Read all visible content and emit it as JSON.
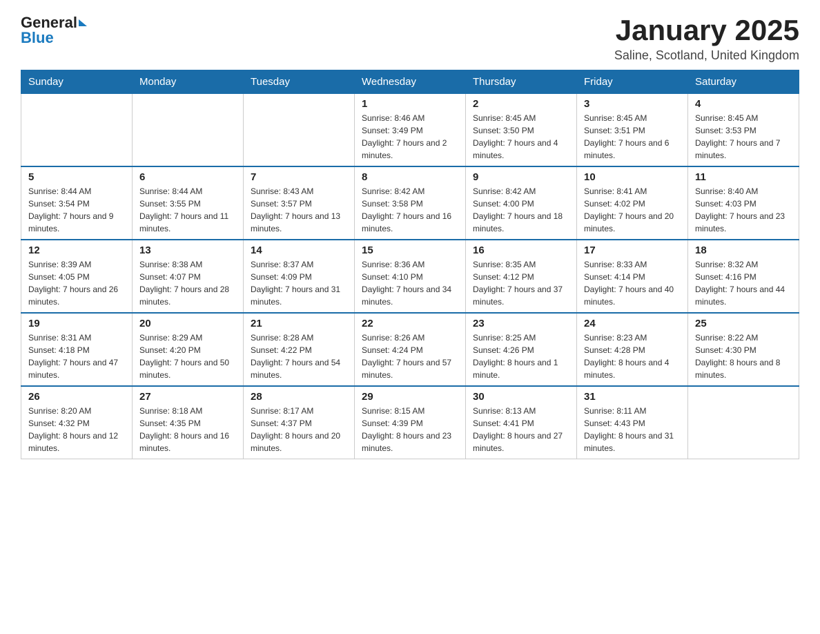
{
  "logo": {
    "text_general": "General",
    "text_blue": "Blue"
  },
  "header": {
    "month": "January 2025",
    "location": "Saline, Scotland, United Kingdom"
  },
  "days_of_week": [
    "Sunday",
    "Monday",
    "Tuesday",
    "Wednesday",
    "Thursday",
    "Friday",
    "Saturday"
  ],
  "weeks": [
    [
      {
        "day": "",
        "info": ""
      },
      {
        "day": "",
        "info": ""
      },
      {
        "day": "",
        "info": ""
      },
      {
        "day": "1",
        "info": "Sunrise: 8:46 AM\nSunset: 3:49 PM\nDaylight: 7 hours and 2 minutes."
      },
      {
        "day": "2",
        "info": "Sunrise: 8:45 AM\nSunset: 3:50 PM\nDaylight: 7 hours and 4 minutes."
      },
      {
        "day": "3",
        "info": "Sunrise: 8:45 AM\nSunset: 3:51 PM\nDaylight: 7 hours and 6 minutes."
      },
      {
        "day": "4",
        "info": "Sunrise: 8:45 AM\nSunset: 3:53 PM\nDaylight: 7 hours and 7 minutes."
      }
    ],
    [
      {
        "day": "5",
        "info": "Sunrise: 8:44 AM\nSunset: 3:54 PM\nDaylight: 7 hours and 9 minutes."
      },
      {
        "day": "6",
        "info": "Sunrise: 8:44 AM\nSunset: 3:55 PM\nDaylight: 7 hours and 11 minutes."
      },
      {
        "day": "7",
        "info": "Sunrise: 8:43 AM\nSunset: 3:57 PM\nDaylight: 7 hours and 13 minutes."
      },
      {
        "day": "8",
        "info": "Sunrise: 8:42 AM\nSunset: 3:58 PM\nDaylight: 7 hours and 16 minutes."
      },
      {
        "day": "9",
        "info": "Sunrise: 8:42 AM\nSunset: 4:00 PM\nDaylight: 7 hours and 18 minutes."
      },
      {
        "day": "10",
        "info": "Sunrise: 8:41 AM\nSunset: 4:02 PM\nDaylight: 7 hours and 20 minutes."
      },
      {
        "day": "11",
        "info": "Sunrise: 8:40 AM\nSunset: 4:03 PM\nDaylight: 7 hours and 23 minutes."
      }
    ],
    [
      {
        "day": "12",
        "info": "Sunrise: 8:39 AM\nSunset: 4:05 PM\nDaylight: 7 hours and 26 minutes."
      },
      {
        "day": "13",
        "info": "Sunrise: 8:38 AM\nSunset: 4:07 PM\nDaylight: 7 hours and 28 minutes."
      },
      {
        "day": "14",
        "info": "Sunrise: 8:37 AM\nSunset: 4:09 PM\nDaylight: 7 hours and 31 minutes."
      },
      {
        "day": "15",
        "info": "Sunrise: 8:36 AM\nSunset: 4:10 PM\nDaylight: 7 hours and 34 minutes."
      },
      {
        "day": "16",
        "info": "Sunrise: 8:35 AM\nSunset: 4:12 PM\nDaylight: 7 hours and 37 minutes."
      },
      {
        "day": "17",
        "info": "Sunrise: 8:33 AM\nSunset: 4:14 PM\nDaylight: 7 hours and 40 minutes."
      },
      {
        "day": "18",
        "info": "Sunrise: 8:32 AM\nSunset: 4:16 PM\nDaylight: 7 hours and 44 minutes."
      }
    ],
    [
      {
        "day": "19",
        "info": "Sunrise: 8:31 AM\nSunset: 4:18 PM\nDaylight: 7 hours and 47 minutes."
      },
      {
        "day": "20",
        "info": "Sunrise: 8:29 AM\nSunset: 4:20 PM\nDaylight: 7 hours and 50 minutes."
      },
      {
        "day": "21",
        "info": "Sunrise: 8:28 AM\nSunset: 4:22 PM\nDaylight: 7 hours and 54 minutes."
      },
      {
        "day": "22",
        "info": "Sunrise: 8:26 AM\nSunset: 4:24 PM\nDaylight: 7 hours and 57 minutes."
      },
      {
        "day": "23",
        "info": "Sunrise: 8:25 AM\nSunset: 4:26 PM\nDaylight: 8 hours and 1 minute."
      },
      {
        "day": "24",
        "info": "Sunrise: 8:23 AM\nSunset: 4:28 PM\nDaylight: 8 hours and 4 minutes."
      },
      {
        "day": "25",
        "info": "Sunrise: 8:22 AM\nSunset: 4:30 PM\nDaylight: 8 hours and 8 minutes."
      }
    ],
    [
      {
        "day": "26",
        "info": "Sunrise: 8:20 AM\nSunset: 4:32 PM\nDaylight: 8 hours and 12 minutes."
      },
      {
        "day": "27",
        "info": "Sunrise: 8:18 AM\nSunset: 4:35 PM\nDaylight: 8 hours and 16 minutes."
      },
      {
        "day": "28",
        "info": "Sunrise: 8:17 AM\nSunset: 4:37 PM\nDaylight: 8 hours and 20 minutes."
      },
      {
        "day": "29",
        "info": "Sunrise: 8:15 AM\nSunset: 4:39 PM\nDaylight: 8 hours and 23 minutes."
      },
      {
        "day": "30",
        "info": "Sunrise: 8:13 AM\nSunset: 4:41 PM\nDaylight: 8 hours and 27 minutes."
      },
      {
        "day": "31",
        "info": "Sunrise: 8:11 AM\nSunset: 4:43 PM\nDaylight: 8 hours and 31 minutes."
      },
      {
        "day": "",
        "info": ""
      }
    ]
  ]
}
